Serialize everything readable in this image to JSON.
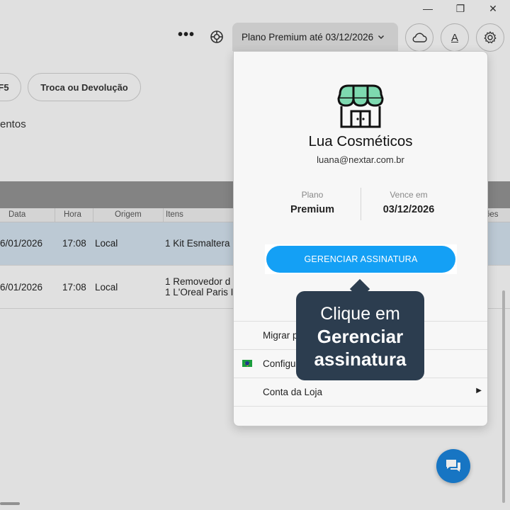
{
  "window": {
    "minimize": "—",
    "maximize": "❐",
    "close": "✕"
  },
  "toolbar": {
    "more": "•••",
    "plan_label": "Plano Premium até 03/12/2026",
    "font_label": "A"
  },
  "actions": {
    "pill_partial": "F5",
    "troca": "Troca ou Devolução"
  },
  "section_text": "entos",
  "table": {
    "columns": [
      "Data",
      "Hora",
      "Origem",
      "Itens",
      "ões"
    ],
    "rows": [
      {
        "data": "6/01/2026",
        "hora": "17:08",
        "origem": "Local",
        "itens": [
          "1  Kit Esmaltera"
        ]
      },
      {
        "data": "6/01/2026",
        "hora": "17:08",
        "origem": "Local",
        "itens": [
          "1  Removedor d",
          "1  L'Oreal Paris I"
        ]
      }
    ]
  },
  "popup": {
    "store_name": "Lua Cosméticos",
    "email": "luana@nextar.com.br",
    "plan_label": "Plano",
    "plan_value": "Premium",
    "due_label": "Vence em",
    "due_value": "03/12/2026",
    "manage_button": "GERENCIAR ASSINATURA",
    "menu": [
      {
        "label": "Migrar p"
      },
      {
        "label": "Configu"
      },
      {
        "label": "Conta da Loja"
      }
    ]
  },
  "tooltip": {
    "line1": "Clique em",
    "line2": "Gerenciar",
    "line3": "assinatura"
  },
  "colors": {
    "accent": "#14a0f5",
    "tooltip_bg": "#2c3d4f",
    "chat_fab": "#1a7fd4",
    "selected_row": "#cddbe6"
  }
}
